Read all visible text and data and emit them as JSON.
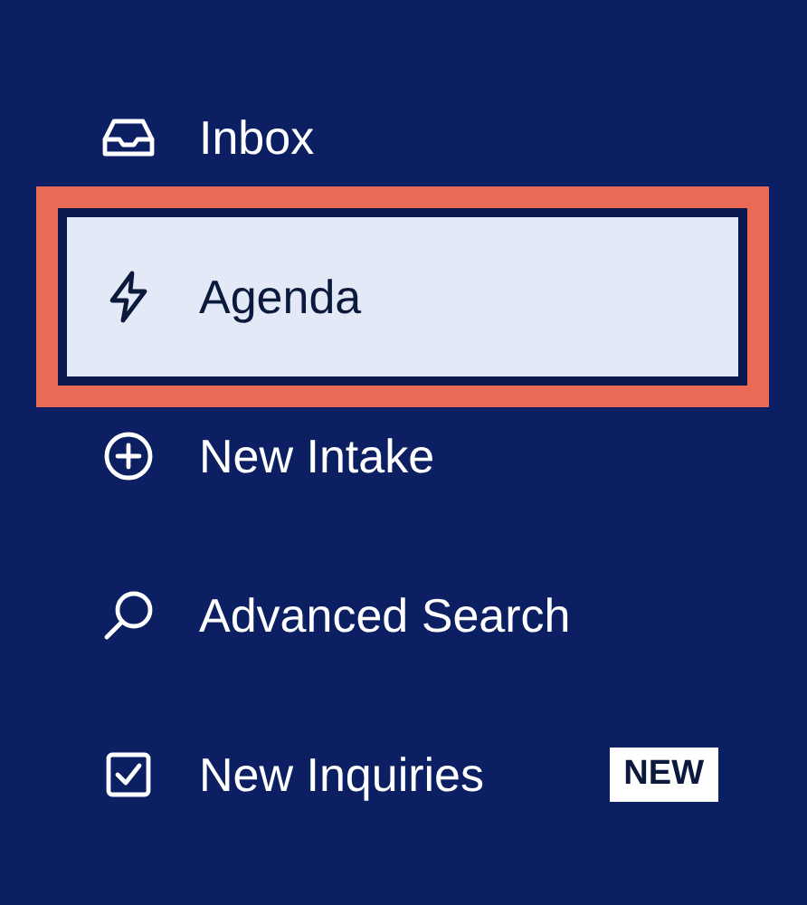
{
  "nav": {
    "items": [
      {
        "label": "Inbox",
        "selected": false
      },
      {
        "label": "Agenda",
        "selected": true
      },
      {
        "label": "New Intake",
        "selected": false
      },
      {
        "label": "Advanced Search",
        "selected": false
      },
      {
        "label": "New Inquiries",
        "selected": false,
        "badge": "NEW"
      }
    ]
  }
}
